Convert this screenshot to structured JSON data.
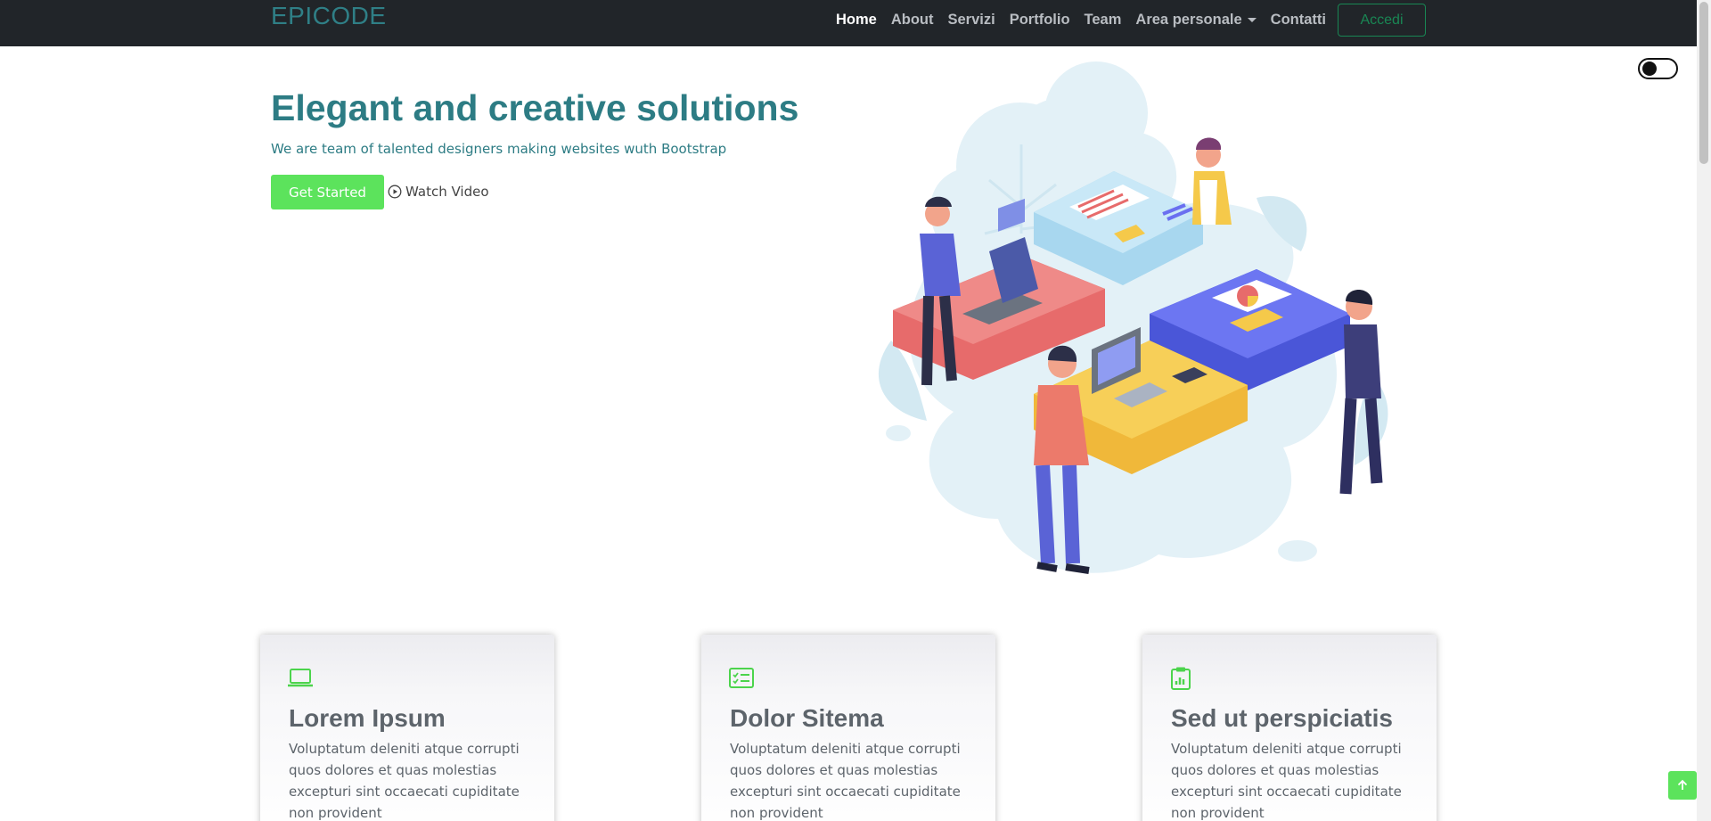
{
  "navbar": {
    "brand": "EPICODE",
    "links": [
      {
        "label": "Home",
        "active": true
      },
      {
        "label": "About"
      },
      {
        "label": "Servizi"
      },
      {
        "label": "Portfolio"
      },
      {
        "label": "Team"
      },
      {
        "label": "Area personale",
        "dropdown": true
      },
      {
        "label": "Contatti"
      }
    ],
    "login_label": "Accedi"
  },
  "hero": {
    "title": "Elegant and creative solutions",
    "subtitle": "We are team of talented designers making websites wuth Bootstrap",
    "cta_label": "Get Started",
    "video_label": "Watch Video"
  },
  "cards": [
    {
      "icon": "laptop-icon",
      "title": "Lorem Ipsum",
      "text": "Voluptatum deleniti atque corrupti quos dolores et quas molestias excepturi sint occaecati cupiditate non provident"
    },
    {
      "icon": "checklist-icon",
      "title": "Dolor Sitema",
      "text": "Voluptatum deleniti atque corrupti quos dolores et quas molestias excepturi sint occaecati cupiditate non provident"
    },
    {
      "icon": "clipboard-chart-icon",
      "title": "Sed ut perspiciatis",
      "text": "Voluptatum deleniti atque corrupti quos dolores et quas molestias excepturi sint occaecati cupiditate non provident"
    }
  ],
  "colors": {
    "brand": "#2d7c84",
    "accent_green": "#5ce35c",
    "navbar_bg": "#212529",
    "login_border": "#198754"
  }
}
